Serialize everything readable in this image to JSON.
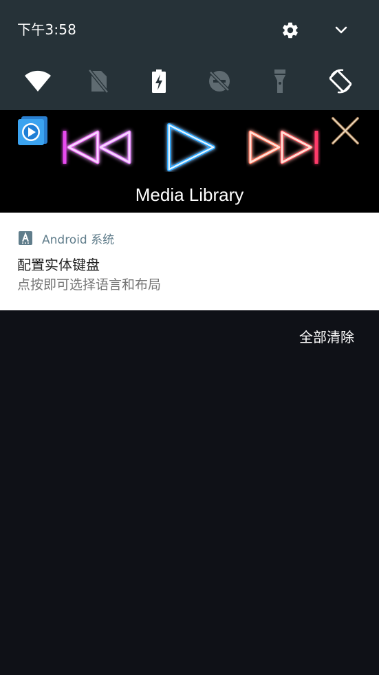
{
  "status": {
    "time": "下午3:58"
  },
  "header": {
    "settings_icon": "gear-icon",
    "expand_icon": "chevron-down-icon"
  },
  "quick_settings": [
    {
      "name": "wifi",
      "icon": "wifi-icon",
      "active": true
    },
    {
      "name": "sim",
      "icon": "no-sim-icon",
      "active": false
    },
    {
      "name": "battery",
      "icon": "battery-charging-icon",
      "active": true
    },
    {
      "name": "do-not-disturb",
      "icon": "dnd-off-icon",
      "active": false
    },
    {
      "name": "flashlight",
      "icon": "flashlight-icon",
      "active": false
    },
    {
      "name": "auto-rotate",
      "icon": "auto-rotate-icon",
      "active": true
    }
  ],
  "media": {
    "title": "Media Library",
    "icons": [
      "media-library-app-icon",
      "previous-icon",
      "play-icon",
      "next-icon",
      "close-icon"
    ]
  },
  "notification": {
    "app_name": "Android 系统",
    "app_icon": "android-system-icon",
    "title": "配置实体键盘",
    "text": "点按即可选择语言和布局"
  },
  "actions": {
    "clear_all": "全部清除"
  },
  "colors": {
    "shade": "#263238",
    "background": "#0f1117",
    "notif_app": "#607d8b"
  }
}
